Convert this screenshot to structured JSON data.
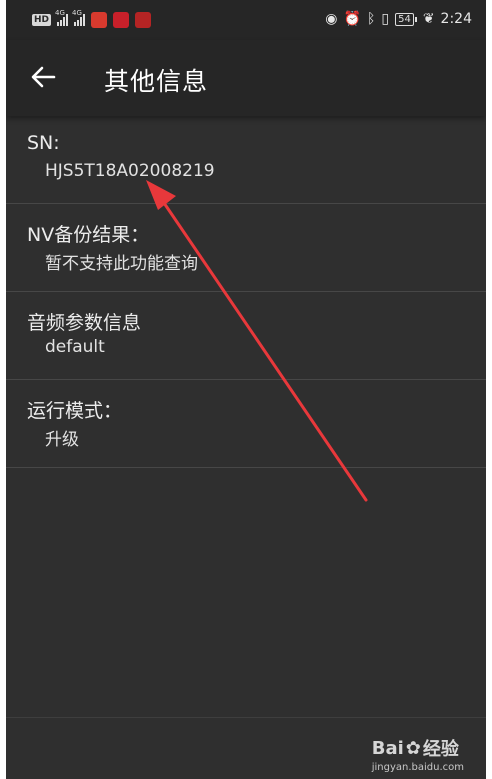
{
  "status_bar": {
    "hd": "HD",
    "net1": "4G",
    "net2": "4G",
    "battery": "54",
    "time": "2:24"
  },
  "app_bar": {
    "title": "其他信息"
  },
  "items": [
    {
      "title": "SN:",
      "value": "HJS5T18A02008219"
    },
    {
      "title": "NV备份结果：",
      "value": "暂不支持此功能查询"
    },
    {
      "title": "音频参数信息",
      "value": "default"
    },
    {
      "title": "运行模式：",
      "value": "升级"
    }
  ],
  "watermark": {
    "brand": "Bai",
    "brand_cn": "经验",
    "url": "jingyan.baidu.com"
  },
  "colors": {
    "background": "#2f2f2f",
    "bar": "#262626",
    "annotation_arrow": "#e8383b"
  }
}
